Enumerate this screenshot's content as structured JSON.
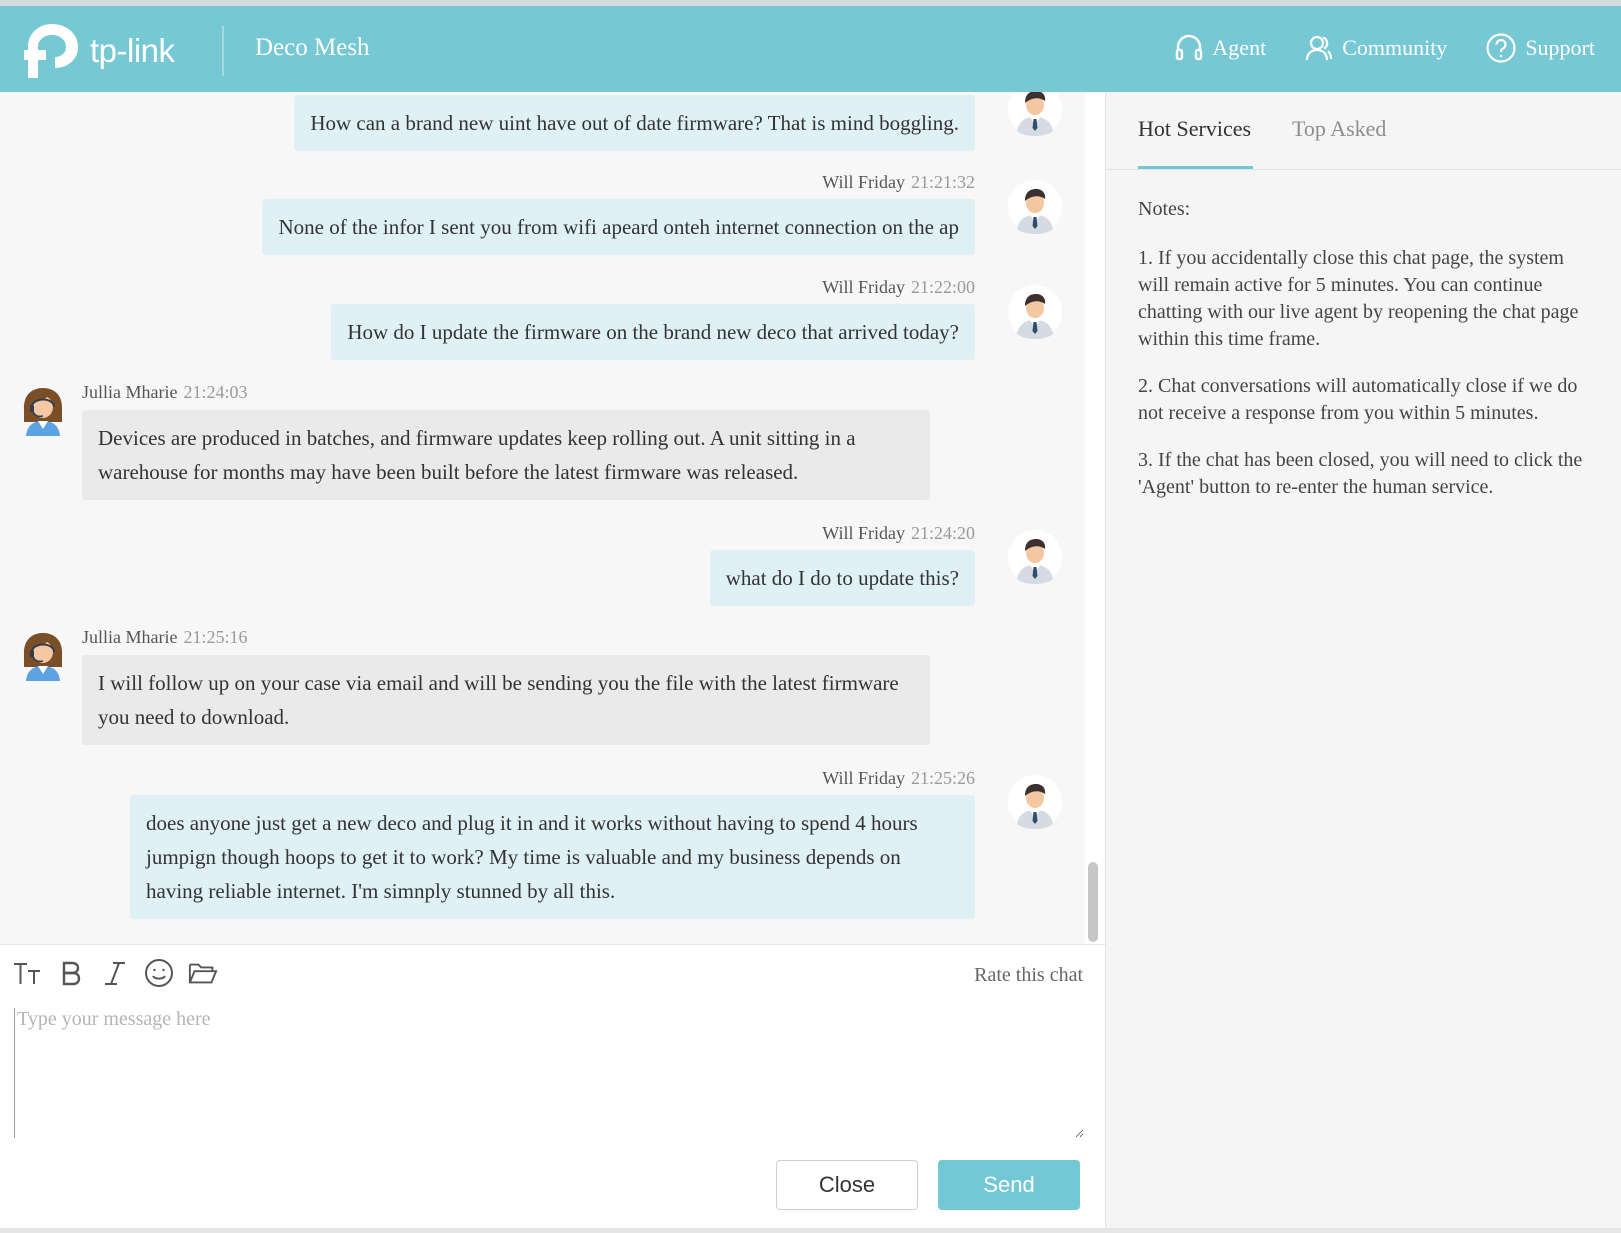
{
  "header": {
    "logo_text": "tp-link",
    "product": "Deco Mesh",
    "nav": [
      {
        "label": "Agent",
        "icon": "headset-icon"
      },
      {
        "label": "Community",
        "icon": "users-icon"
      },
      {
        "label": "Support",
        "icon": "question-circle-icon"
      }
    ]
  },
  "messages": [
    {
      "text": "How can a brand new uint have out of date firmware?  That is mind boggling."
    },
    {
      "author": "Will Friday",
      "time": "21:21:32",
      "text": "None of the infor I sent you from wifi apeard onteh internet connection on the ap"
    },
    {
      "author": "Will Friday",
      "time": "21:22:00",
      "text": "How do I update the firmware on the brand new deco that arrived today?"
    },
    {
      "author": "Jullia Mharie",
      "time": "21:24:03",
      "text": "Devices are produced in batches, and firmware updates keep rolling out. A unit sitting in a warehouse for months may have been built before the latest firmware was released."
    },
    {
      "author": "Will Friday",
      "time": "21:24:20",
      "text": "what do I do to update this?"
    },
    {
      "author": "Jullia Mharie",
      "time": "21:25:16",
      "text": "I will follow up on your case via email and will be sending you the file with the latest firmware you need to download."
    },
    {
      "author": "Will Friday",
      "time": "21:25:26",
      "text": "does anyone just get a new deco and plug it in and it works without having to spend 4 hours jumpign though hoops to get it to work?  My time is valuable and my business depends on having reliable internet.  I'm simnply stunned by all this."
    }
  ],
  "composer": {
    "rate_label": "Rate this chat",
    "placeholder": "Type your message here",
    "close_label": "Close",
    "send_label": "Send",
    "tools": [
      "text-size-icon",
      "bold-icon",
      "italic-icon",
      "emoji-icon",
      "folder-icon"
    ]
  },
  "sidebar": {
    "tabs": [
      {
        "label": "Hot Services",
        "active": true
      },
      {
        "label": "Top Asked",
        "active": false
      }
    ],
    "notes_title": "Notes:",
    "notes": [
      "1. If you accidentally close this chat page, the system will remain active for 5 minutes. You can continue chatting with our live agent by reopening the chat page within this time frame.",
      "2. Chat conversations will automatically close if we do not receive a response from you within 5 minutes.",
      "3. If the chat has been closed, you will need to click the 'Agent' button to re-enter the human service."
    ]
  },
  "colors": {
    "header": "#76c8d5",
    "accent": "#73c8d6",
    "user_bubble": "#dff1f5",
    "agent_bubble": "#eaeaea"
  }
}
